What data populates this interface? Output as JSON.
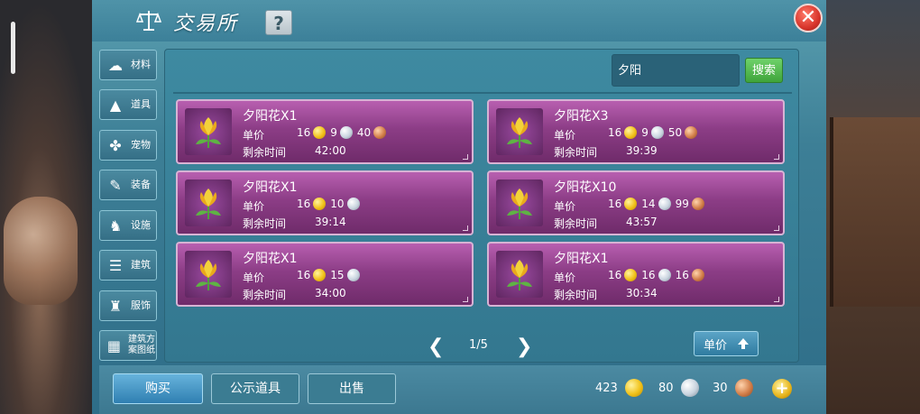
{
  "title": "交易所",
  "help_label": "?",
  "close_label": "✕",
  "categories": [
    {
      "label": "材料",
      "icon": "ore-icon"
    },
    {
      "label": "道具",
      "icon": "potion-icon"
    },
    {
      "label": "宠物",
      "icon": "paw-icon"
    },
    {
      "label": "装备",
      "icon": "sword-icon"
    },
    {
      "label": "设施",
      "icon": "horse-icon"
    },
    {
      "label": "建筑",
      "icon": "wall-icon"
    },
    {
      "label": "服饰",
      "icon": "shirt-icon"
    },
    {
      "label": "建筑方案图纸",
      "icon": "blueprint-icon"
    }
  ],
  "search": {
    "value": "夕阳",
    "button_label": "搜索"
  },
  "listing_labels": {
    "price": "单价",
    "time": "剩余时间"
  },
  "listings": [
    {
      "name": "夕阳花X1",
      "gold": "16",
      "silver": "9",
      "copper": "40",
      "time": "42:00"
    },
    {
      "name": "夕阳花X3",
      "gold": "16",
      "silver": "9",
      "copper": "50",
      "time": "39:39"
    },
    {
      "name": "夕阳花X1",
      "gold": "16",
      "silver": "10",
      "copper": "",
      "time": "39:14"
    },
    {
      "name": "夕阳花X10",
      "gold": "16",
      "silver": "14",
      "copper": "99",
      "time": "43:57"
    },
    {
      "name": "夕阳花X1",
      "gold": "16",
      "silver": "15",
      "copper": "",
      "time": "34:00"
    },
    {
      "name": "夕阳花X1",
      "gold": "16",
      "silver": "16",
      "copper": "16",
      "time": "30:34"
    }
  ],
  "pagination": {
    "text": "1/5",
    "prev": "❮",
    "next": "❯"
  },
  "sort_label": "单价",
  "actions": {
    "buy": "购买",
    "public": "公示道具",
    "sell": "出售"
  },
  "wallet": {
    "gold": "423",
    "silver": "80",
    "copper": "30",
    "add": "+"
  },
  "colors": {
    "card": "#8c3d86",
    "search_button": "#4caf50",
    "buy_button": "#2f7fb1"
  }
}
